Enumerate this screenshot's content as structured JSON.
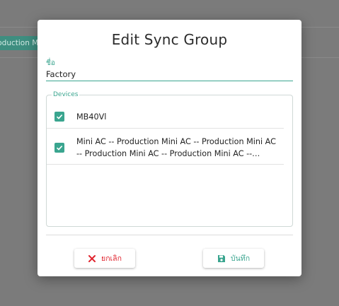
{
  "background": {
    "chip_text": "Production Mini AC"
  },
  "dialog": {
    "title": "Edit Sync Group",
    "name_field": {
      "label": "ชื่อ",
      "value": "Factory"
    },
    "devices": {
      "legend": "Devices",
      "items": [
        {
          "label": "MB40Vl",
          "checked": true
        },
        {
          "label": "Mini AC -- Production Mini AC -- Production Mini AC -- Production Mini AC -- Production Mini AC -- Productio...",
          "checked": true
        }
      ]
    },
    "buttons": {
      "cancel_label": "ยกเลิก",
      "save_label": "บันทึก"
    }
  },
  "colors": {
    "accent": "#3aa58f",
    "danger": "#e0232d",
    "overlay": "#7b7b7b"
  },
  "icons": {
    "cancel": "close-icon",
    "save": "save-icon",
    "checkbox": "check-icon"
  }
}
